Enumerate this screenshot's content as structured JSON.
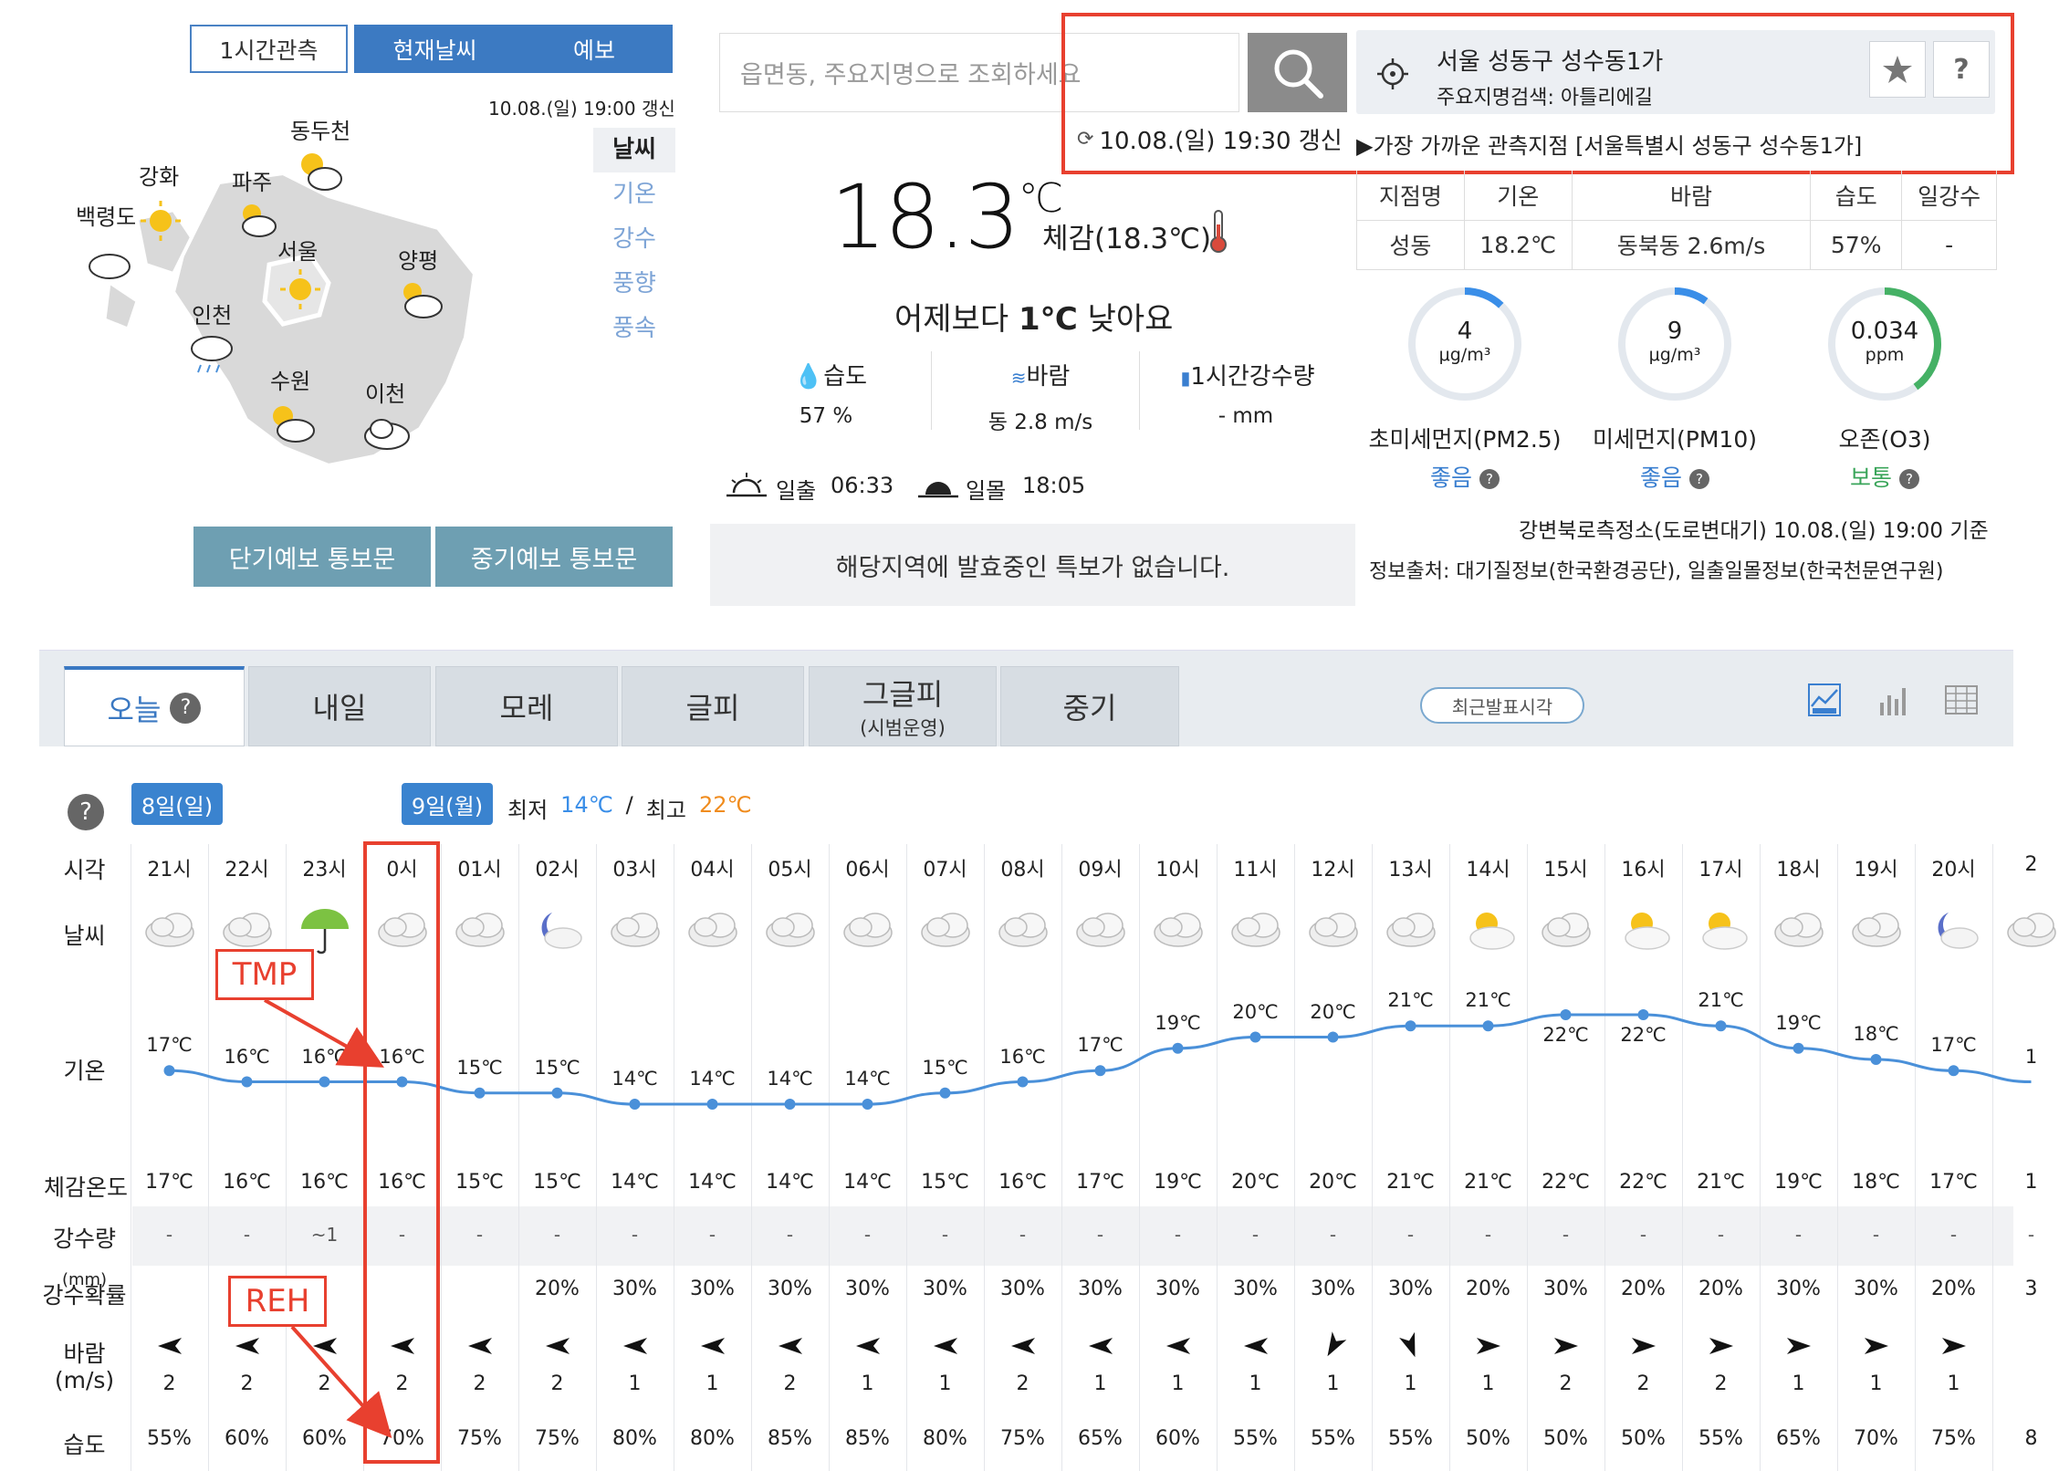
{
  "map": {
    "tabs": [
      "1시간관측",
      "현재날씨",
      "예보"
    ],
    "updated": "10.08.(일) 19:00 갱신",
    "side_nav": [
      "날씨",
      "기온",
      "강수",
      "풍향",
      "풍속"
    ],
    "cities": [
      "동두천",
      "강화",
      "파주",
      "백령도",
      "서울",
      "양평",
      "인천",
      "수원",
      "이천"
    ],
    "buttons": [
      "단기예보 통보문",
      "중기예보 통보문"
    ]
  },
  "search": {
    "placeholder": "읍면동, 주요지명으로 조회하세요",
    "location": "서울 성동구 성수동1가",
    "landmark": "주요지명검색: 아틀리에길",
    "refresh_time": "10.08.(일) 19:30 갱신",
    "nearest_station": "▶가장 가까운 관측지점 [서울특별시 성동구 성수동1가]",
    "star_icon": "star-icon",
    "help_label": "?"
  },
  "current": {
    "temp": "18.3",
    "temp_unit": "℃",
    "feels": "체감(18.3℃)",
    "compare_prefix": "어제보다 ",
    "compare_value": "1℃",
    "compare_suffix": " 낮아요",
    "humidity_label": "습도",
    "humidity_value": "57 %",
    "wind_label": "바람",
    "wind_value": "동 2.8 m/s",
    "rain_label": "1시간강수량",
    "rain_value": "- mm",
    "sunrise_label": "일출",
    "sunrise": "06:33",
    "sunset_label": "일몰",
    "sunset": "18:05",
    "notice": "해당지역에 발효중인 특보가 없습니다."
  },
  "obs_table": {
    "headers": [
      "지점명",
      "기온",
      "바람",
      "습도",
      "일강수"
    ],
    "row": [
      "성동",
      "18.2℃",
      "동북동 2.6m/s",
      "57%",
      "-"
    ]
  },
  "air": {
    "items": [
      {
        "value": "4",
        "unit": "μg/m³",
        "label": "초미세먼지(PM2.5)",
        "status": "좋음",
        "status_color": "#3a7fd0",
        "ring_color": "#3a8ee8",
        "level": 0.12
      },
      {
        "value": "9",
        "unit": "μg/m³",
        "label": "미세먼지(PM10)",
        "status": "좋음",
        "status_color": "#3a7fd0",
        "ring_color": "#3a8ee8",
        "level": 0.1
      },
      {
        "value": "0.034",
        "unit": "ppm",
        "label": "오존(O3)",
        "status": "보통",
        "status_color": "#3aa55a",
        "ring_color": "#45b165",
        "level": 0.4
      }
    ],
    "station": "강변북로측정소(도로변대기) 10.08.(일) 19:00 기준",
    "source": "정보출처: 대기질정보(한국환경공단), 일출일몰정보(한국천문연구원)"
  },
  "forecast": {
    "tabs": [
      "오늘",
      "내일",
      "모레",
      "글피",
      "그글피",
      "중기"
    ],
    "tab_sub": "(시범운영)",
    "recent_btn": "최근발표시각",
    "day1": "8일(일)",
    "day2": "9일(월)",
    "min_label": "최저",
    "min": "14℃",
    "slash": "/",
    "max_label": "최고",
    "max": "22℃",
    "row_labels": [
      "시각",
      "날씨",
      "기온",
      "체감온도",
      "강수량",
      "(mm)",
      "강수확률",
      "바람",
      "(m/s)",
      "습도"
    ],
    "annotation_tmp": "TMP",
    "annotation_reh": "REH",
    "hours": [
      "21시",
      "22시",
      "23시",
      "0시",
      "01시",
      "02시",
      "03시",
      "04시",
      "05시",
      "06시",
      "07시",
      "08시",
      "09시",
      "10시",
      "11시",
      "12시",
      "13시",
      "14시",
      "15시",
      "16시",
      "17시",
      "18시",
      "19시",
      "20시",
      "2"
    ],
    "weather_icons": [
      "cloud",
      "cloud",
      "umbrella",
      "cloud",
      "cloud",
      "moon-cloud",
      "cloud",
      "cloud",
      "cloud",
      "cloud",
      "cloud",
      "cloud",
      "cloud",
      "cloud",
      "cloud",
      "cloud",
      "cloud",
      "sun-cloud",
      "cloud",
      "sun-cloud",
      "sun-cloud",
      "cloud",
      "cloud",
      "moon-cloud",
      "cloud"
    ],
    "temps": [
      17,
      16,
      16,
      16,
      15,
      15,
      14,
      14,
      14,
      14,
      15,
      16,
      17,
      19,
      20,
      20,
      21,
      21,
      22,
      22,
      21,
      19,
      18,
      17,
      16
    ],
    "temp_labels": [
      "17℃",
      "16℃",
      "16℃",
      "16℃",
      "15℃",
      "15℃",
      "14℃",
      "14℃",
      "14℃",
      "14℃",
      "15℃",
      "16℃",
      "17℃",
      "19℃",
      "20℃",
      "20℃",
      "21℃",
      "21℃",
      "22℃",
      "22℃",
      "21℃",
      "19℃",
      "18℃",
      "17℃",
      "1"
    ],
    "feels": [
      "17℃",
      "16℃",
      "16℃",
      "16℃",
      "15℃",
      "15℃",
      "14℃",
      "14℃",
      "14℃",
      "14℃",
      "15℃",
      "16℃",
      "17℃",
      "19℃",
      "20℃",
      "20℃",
      "21℃",
      "21℃",
      "22℃",
      "22℃",
      "21℃",
      "19℃",
      "18℃",
      "17℃",
      "1"
    ],
    "rain": [
      "-",
      "-",
      "~1",
      "-",
      "-",
      "-",
      "-",
      "-",
      "-",
      "-",
      "-",
      "-",
      "-",
      "-",
      "-",
      "-",
      "-",
      "-",
      "-",
      "-",
      "-",
      "-",
      "-",
      "-",
      "-"
    ],
    "prob": [
      "",
      "",
      "",
      "",
      "",
      "20%",
      "30%",
      "30%",
      "30%",
      "30%",
      "30%",
      "30%",
      "30%",
      "30%",
      "30%",
      "30%",
      "30%",
      "20%",
      "30%",
      "20%",
      "20%",
      "30%",
      "30%",
      "20%",
      "3"
    ],
    "wind_dirs": [
      0,
      0,
      0,
      0,
      0,
      0,
      0,
      0,
      0,
      0,
      0,
      0,
      0,
      0,
      0,
      -60,
      -110,
      180,
      180,
      180,
      180,
      180,
      180,
      180,
      0
    ],
    "wind_speeds": [
      "2",
      "2",
      "2",
      "2",
      "2",
      "2",
      "1",
      "1",
      "2",
      "1",
      "1",
      "2",
      "1",
      "1",
      "1",
      "1",
      "1",
      "1",
      "2",
      "2",
      "2",
      "1",
      "1",
      "1",
      ""
    ],
    "humidity": [
      "55%",
      "60%",
      "60%",
      "70%",
      "75%",
      "75%",
      "80%",
      "80%",
      "85%",
      "85%",
      "80%",
      "75%",
      "65%",
      "60%",
      "55%",
      "55%",
      "55%",
      "50%",
      "50%",
      "50%",
      "55%",
      "65%",
      "70%",
      "75%",
      "8"
    ]
  },
  "colors": {
    "accent": "#3a7fd0",
    "annotation": "#e8402f",
    "min": "#3a8ee8",
    "max": "#f08c1e",
    "line": "#4a90d9"
  }
}
